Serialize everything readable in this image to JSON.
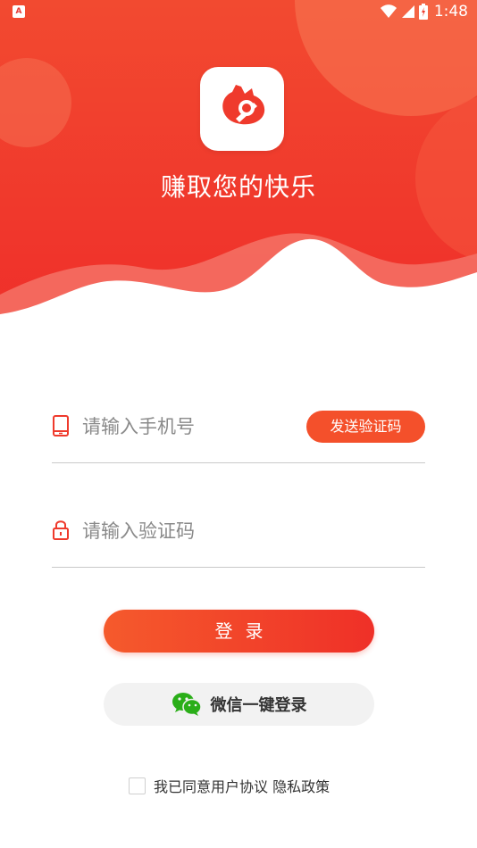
{
  "status_bar": {
    "time": "1:48",
    "notification_icon": "a-notification-icon"
  },
  "header": {
    "slogan": "赚取您的快乐",
    "logo_icon": "app-logo-icon",
    "bg_color": "#f2392d"
  },
  "phone_field": {
    "placeholder": "请输入手机号",
    "icon": "phone-icon",
    "send_code_label": "发送验证码"
  },
  "code_field": {
    "placeholder": "请输入验证码",
    "icon": "lock-icon"
  },
  "login_button": {
    "label": "登录"
  },
  "wechat_button": {
    "label": "微信一键登录",
    "icon": "wechat-icon"
  },
  "agreement": {
    "text": "我已同意用户协议 隐私政策"
  },
  "colors": {
    "accent": "#f4502b",
    "primary": "#ef3028",
    "wechat": "#2aae18"
  }
}
